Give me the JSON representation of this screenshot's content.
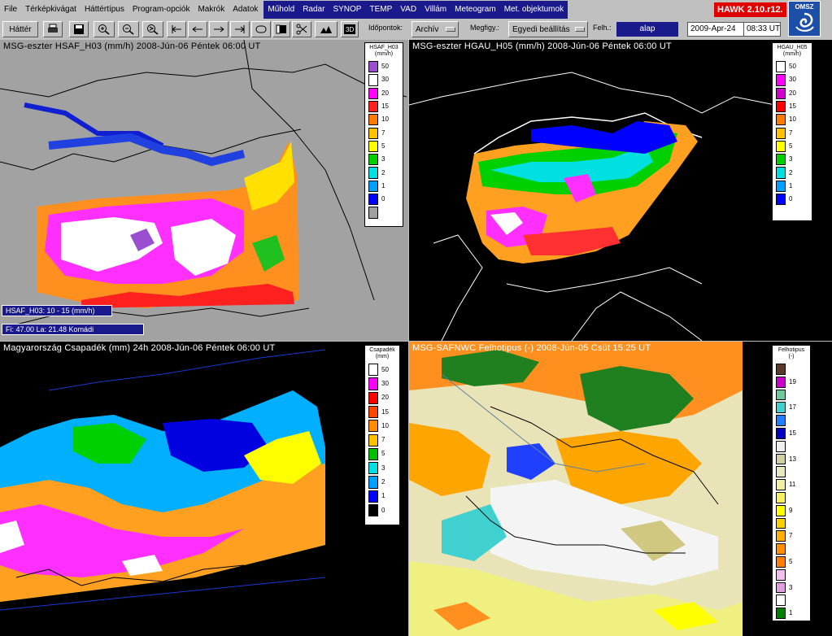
{
  "menu": {
    "items": [
      "File",
      "Térképkivágat",
      "Háttértípus",
      "Program-opciók",
      "Makrók",
      "Adatok"
    ],
    "highlighted": [
      "Műhold",
      "Radar",
      "SYNOP",
      "TEMP",
      "VAD",
      "Villám",
      "Meteogram",
      "Met. objektumok"
    ]
  },
  "app_badge": "HAWK 2.10.r12.",
  "logo": "OMSZ",
  "toolbar": {
    "hatter_label": "Háttér",
    "idopontok_label": "Időpontok:",
    "archiv_value": "Archív",
    "megfigy_label": "Megfigy.:",
    "megfigy_value": "Egyedi beállítás",
    "felh_label": "Felh.:",
    "felh_value": "alap",
    "date": "2009-Apr-24",
    "time": "08:33 UT"
  },
  "panels": [
    {
      "title": "MSG-eszter  HSAF_H03 (mm/h)  2008-Jún-06 Péntek 06:00 UT",
      "legend_title": "HSAF_H03",
      "legend_unit": "(mm/h)",
      "legend": [
        {
          "label": "50",
          "color": "#9a4fd0"
        },
        {
          "label": "30",
          "color": "#ffffff"
        },
        {
          "label": "20",
          "color": "#ff00ff"
        },
        {
          "label": "15",
          "color": "#ff2020"
        },
        {
          "label": "10",
          "color": "#ff7a00"
        },
        {
          "label": "7",
          "color": "#ffc000"
        },
        {
          "label": "5",
          "color": "#ffff00"
        },
        {
          "label": "3",
          "color": "#00d000"
        },
        {
          "label": "2",
          "color": "#00e0e0"
        },
        {
          "label": "1",
          "color": "#00a0ff"
        },
        {
          "label": "0",
          "color": "#0000ff"
        },
        {
          "label": "",
          "color": "#a0a0a0"
        }
      ],
      "info1": "HSAF_H03: 10 - 15 (mm/h)",
      "info2": "Fi:  47.00  La:   21.48  Komádi"
    },
    {
      "title": "MSG-eszter  HGAU_H05 (mm/h)  2008-Jún-06 Péntek 06:00 UT",
      "legend_title": "HGAU_H05",
      "legend_unit": "(mm/h)",
      "legend": [
        {
          "label": "50",
          "color": "#ffffff"
        },
        {
          "label": "30",
          "color": "#ff00ff"
        },
        {
          "label": "20",
          "color": "#d000d0"
        },
        {
          "label": "15",
          "color": "#ff0000"
        },
        {
          "label": "10",
          "color": "#ff7a00"
        },
        {
          "label": "7",
          "color": "#ffc000"
        },
        {
          "label": "5",
          "color": "#ffff00"
        },
        {
          "label": "3",
          "color": "#00d000"
        },
        {
          "label": "2",
          "color": "#00e0e0"
        },
        {
          "label": "1",
          "color": "#00a0ff"
        },
        {
          "label": "0",
          "color": "#0000ff"
        }
      ]
    },
    {
      "title": "Magyarország Csapadék (mm)  24h  2008-Jún-06 Péntek 06:00 UT",
      "legend_title": "Csapadék",
      "legend_unit": "(mm)",
      "legend": [
        {
          "label": "50",
          "color": "#ffffff"
        },
        {
          "label": "30",
          "color": "#ff00ff"
        },
        {
          "label": "20",
          "color": "#ff0000"
        },
        {
          "label": "15",
          "color": "#ff4500"
        },
        {
          "label": "10",
          "color": "#ff8c00"
        },
        {
          "label": "7",
          "color": "#ffc000"
        },
        {
          "label": "5",
          "color": "#00c000"
        },
        {
          "label": "3",
          "color": "#00e0e0"
        },
        {
          "label": "2",
          "color": "#00a0ff"
        },
        {
          "label": "1",
          "color": "#0000ff"
        },
        {
          "label": "0",
          "color": "#000000"
        }
      ]
    },
    {
      "title": "MSG-SAFNWC  Felhotipus (-)  2008-Jún-05 Csüt 15:25 UT",
      "legend_title": "Felhotipus",
      "legend_unit": "(-)",
      "legend": [
        {
          "label": "",
          "color": "#5a3a2a"
        },
        {
          "label": "19",
          "color": "#cc00cc"
        },
        {
          "label": "",
          "color": "#70c8a0"
        },
        {
          "label": "17",
          "color": "#40d0d0"
        },
        {
          "label": "",
          "color": "#2080ff"
        },
        {
          "label": "15",
          "color": "#0000c0"
        },
        {
          "label": "",
          "color": "#f0f0f0"
        },
        {
          "label": "13",
          "color": "#d0d0a0"
        },
        {
          "label": "",
          "color": "#e8e8c0"
        },
        {
          "label": "11",
          "color": "#f0f0a0"
        },
        {
          "label": "",
          "color": "#f8f060"
        },
        {
          "label": "9",
          "color": "#ffff00"
        },
        {
          "label": "",
          "color": "#ffd000"
        },
        {
          "label": "7",
          "color": "#ffb000"
        },
        {
          "label": "",
          "color": "#ff9000"
        },
        {
          "label": "5",
          "color": "#ff8000"
        },
        {
          "label": "",
          "color": "#f0c0f0"
        },
        {
          "label": "3",
          "color": "#e0a0e0"
        },
        {
          "label": "",
          "color": "#ffffff"
        },
        {
          "label": "1",
          "color": "#008000"
        }
      ]
    }
  ]
}
